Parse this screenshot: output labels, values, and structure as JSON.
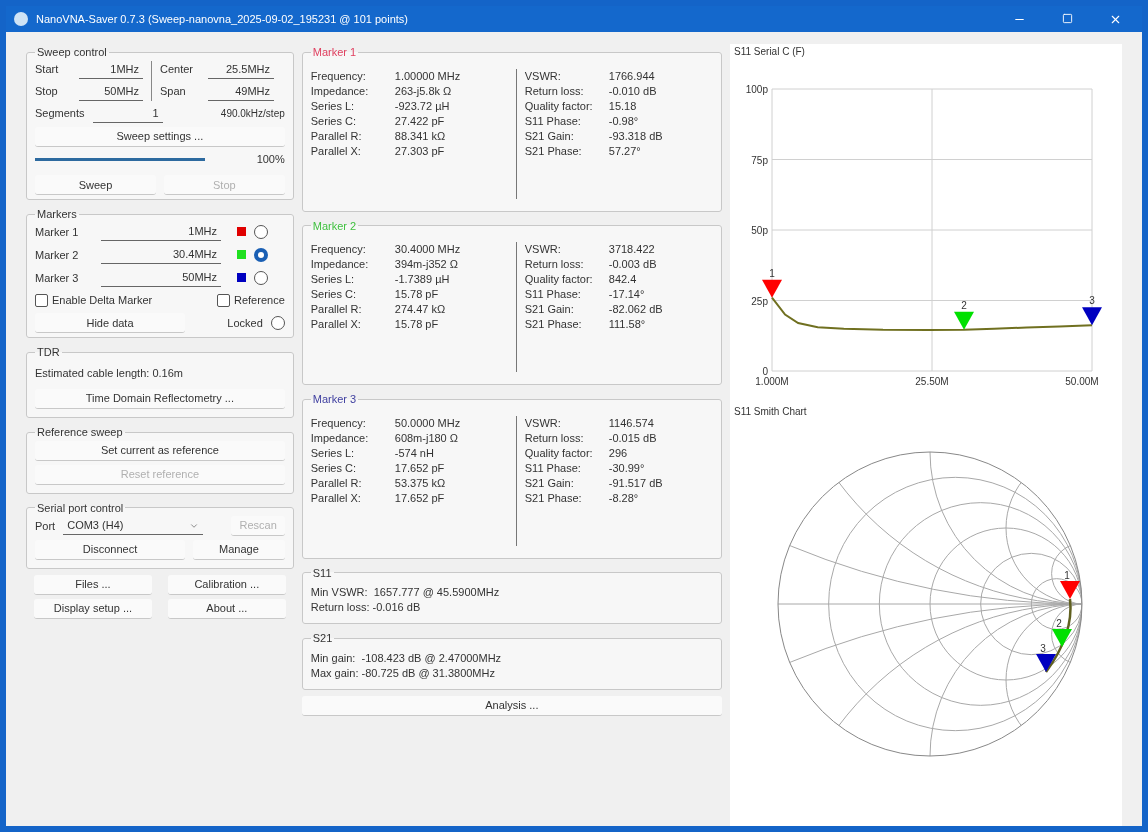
{
  "window": {
    "title": "NanoVNA-Saver 0.7.3 (Sweep-nanovna_2025-09-02_195231 @ 101 points)"
  },
  "sweep_control": {
    "title": "Sweep control",
    "fields": [
      {
        "label": "Start",
        "value": "1MHz"
      },
      {
        "label": "Center",
        "value": "25.5MHz"
      },
      {
        "label": "Stop",
        "value": "50MHz"
      },
      {
        "label": "Span",
        "value": "49MHz"
      }
    ],
    "segments": {
      "label": "Segments",
      "value": "1"
    },
    "step": "490.0kHz/step",
    "settings_button": "Sweep settings ...",
    "progress": {
      "level": 1,
      "reading": "100%"
    },
    "buttons": [
      {
        "label": "Sweep",
        "disabled": false
      },
      {
        "label": "Stop",
        "disabled": true
      }
    ]
  },
  "markers": {
    "title": "Markers",
    "items": [
      {
        "label": "Marker 1",
        "value": "1MHz",
        "color": "#e00000",
        "selected": false
      },
      {
        "label": "Marker 2",
        "value": "30.4MHz",
        "color": "#20e020",
        "selected": true
      },
      {
        "label": "Marker 3",
        "value": "50MHz",
        "color": "#0000c0",
        "selected": false
      }
    ],
    "delta": {
      "label": "Enable Delta Marker",
      "checked": false
    },
    "reference": {
      "label": "Reference",
      "checked": false
    },
    "hide_button": "Hide data",
    "locked": {
      "label": "Locked",
      "checked": false
    }
  },
  "tdr": {
    "title": "TDR",
    "text": "Estimated cable length: 0.16m",
    "button": "Time Domain Reflectometry ..."
  },
  "reference_sweep": {
    "title": "Reference sweep",
    "buttons": [
      {
        "label": "Set current as reference",
        "disabled": false
      },
      {
        "label": "Reset reference",
        "disabled": true
      }
    ]
  },
  "serial_port": {
    "title": "Serial port control",
    "port_label": "Port",
    "port_value": "COM3 (H4)",
    "rescan": {
      "label": "Rescan",
      "disabled": true
    },
    "buttons": [
      {
        "label": "Disconnect",
        "disabled": false
      },
      {
        "label": "Manage",
        "disabled": false
      }
    ]
  },
  "bottom_buttons": [
    "Files ...",
    "Calibration ...",
    "Display setup ...",
    "About ..."
  ],
  "marker_panels": [
    {
      "title": "Marker 1",
      "color": "#e04060",
      "left": [
        {
          "label": "Frequency:",
          "value": "1.00000 MHz"
        },
        {
          "label": "Impedance:",
          "value": "263-j5.8k Ω"
        },
        {
          "label": "Series L:",
          "value": "-923.72 µH"
        },
        {
          "label": "Series C:",
          "value": "27.422 pF"
        },
        {
          "label": "Parallel R:",
          "value": "88.341 kΩ"
        },
        {
          "label": "Parallel X:",
          "value": "27.303 pF"
        }
      ],
      "right": [
        {
          "label": "VSWR:",
          "value": "1766.944"
        },
        {
          "label": "Return loss:",
          "value": "-0.010 dB"
        },
        {
          "label": "Quality factor:",
          "value": "15.18"
        },
        {
          "label": "S11 Phase:",
          "value": "-0.98°"
        },
        {
          "label": "S21 Gain:",
          "value": "-93.318 dB"
        },
        {
          "label": "S21 Phase:",
          "value": "57.27°"
        }
      ]
    },
    {
      "title": "Marker 2",
      "color": "#40c040",
      "left": [
        {
          "label": "Frequency:",
          "value": "30.4000 MHz"
        },
        {
          "label": "Impedance:",
          "value": "394m-j352 Ω"
        },
        {
          "label": "Series L:",
          "value": "-1.7389 µH"
        },
        {
          "label": "Series C:",
          "value": "15.78 pF"
        },
        {
          "label": "Parallel R:",
          "value": "274.47 kΩ"
        },
        {
          "label": "Parallel X:",
          "value": "15.78 pF"
        }
      ],
      "right": [
        {
          "label": "VSWR:",
          "value": "3718.422"
        },
        {
          "label": "Return loss:",
          "value": "-0.003 dB"
        },
        {
          "label": "Quality factor:",
          "value": "842.4"
        },
        {
          "label": "S11 Phase:",
          "value": "-17.14°"
        },
        {
          "label": "S21 Gain:",
          "value": "-82.062 dB"
        },
        {
          "label": "S21 Phase:",
          "value": "111.58°"
        }
      ]
    },
    {
      "title": "Marker 3",
      "color": "#4040a0",
      "left": [
        {
          "label": "Frequency:",
          "value": "50.0000 MHz"
        },
        {
          "label": "Impedance:",
          "value": "608m-j180 Ω"
        },
        {
          "label": "Series L:",
          "value": "-574 nH"
        },
        {
          "label": "Series C:",
          "value": "17.652 pF"
        },
        {
          "label": "Parallel R:",
          "value": "53.375 kΩ"
        },
        {
          "label": "Parallel X:",
          "value": "17.652 pF"
        }
      ],
      "right": [
        {
          "label": "VSWR:",
          "value": "1146.574"
        },
        {
          "label": "Return loss:",
          "value": "-0.015 dB"
        },
        {
          "label": "Quality factor:",
          "value": "296"
        },
        {
          "label": "S11 Phase:",
          "value": "-30.99°"
        },
        {
          "label": "S21 Gain:",
          "value": "-91.517 dB"
        },
        {
          "label": "S21 Phase:",
          "value": "-8.28°"
        }
      ]
    }
  ],
  "s11": {
    "title": "S11",
    "lines": [
      "Min VSWR:  1657.777 @ 45.5900MHz",
      "Return loss: -0.016 dB"
    ]
  },
  "s21": {
    "title": "S21",
    "lines": [
      "Min gain:  -108.423 dB @ 2.47000MHz",
      "Max gain: -80.725 dB @ 31.3800MHz"
    ]
  },
  "analysis_button": "Analysis ...",
  "capacitance_chart": {
    "title": "S11 Serial C (F)",
    "chart_data": {
      "type": "line",
      "x": [
        1,
        3,
        5,
        8,
        12,
        18,
        25,
        30.4,
        35,
        40,
        45,
        50
      ],
      "grid": true,
      "series": [
        {
          "color": "#707020",
          "values": [
            26,
            20,
            17,
            15.5,
            15,
            14.6,
            14.5,
            14.6,
            15,
            15.4,
            15.8,
            16.2
          ]
        }
      ],
      "xlim": [
        1,
        50
      ],
      "ylim": [
        0,
        100
      ],
      "xticks": [
        {
          "value": 1,
          "label": "1.000M"
        },
        {
          "value": 25.5,
          "label": "25.50M"
        },
        {
          "value": 50,
          "label": "50.00M"
        }
      ],
      "yticks": [
        {
          "value": 0,
          "label": "0"
        },
        {
          "value": 25,
          "label": "25p"
        },
        {
          "value": 50,
          "label": "50p"
        },
        {
          "value": 75,
          "label": "75p"
        },
        {
          "value": 100,
          "label": "100p"
        }
      ],
      "annotations": [
        {
          "text": "1",
          "x": 1,
          "y": 26
        },
        {
          "text": "2",
          "x": 30.4,
          "y": 14.6
        },
        {
          "text": "3",
          "x": 50,
          "y": 16.2
        }
      ]
    }
  },
  "smith_chart": {
    "title": "S11 Smith Chart",
    "markers": [
      {
        "label": "1",
        "color": "#ff0000"
      },
      {
        "label": "2",
        "color": "#00e000"
      },
      {
        "label": "3",
        "color": "#0000c0"
      }
    ]
  }
}
